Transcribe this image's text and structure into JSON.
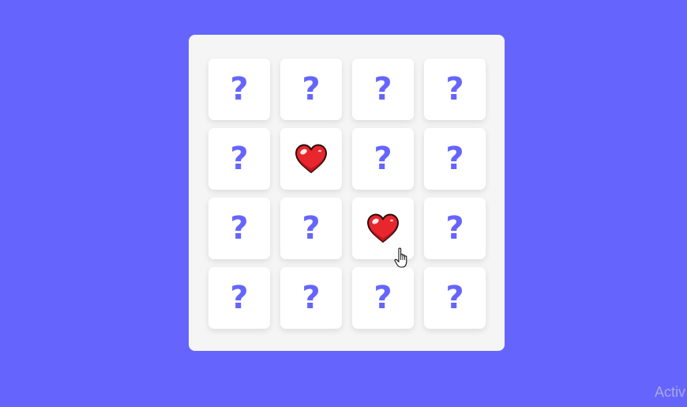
{
  "colors": {
    "background": "#6565fd",
    "board": "#f5f5f5",
    "card": "#ffffff",
    "question_mark": "#6565fd",
    "heart": "#e8262d",
    "watermark": "#a9a9de"
  },
  "hidden_symbol": "?",
  "revealed_symbol_icon": "heart-icon",
  "cards": [
    {
      "state": "hidden"
    },
    {
      "state": "hidden"
    },
    {
      "state": "hidden"
    },
    {
      "state": "hidden"
    },
    {
      "state": "hidden"
    },
    {
      "state": "revealed",
      "icon": "heart-icon"
    },
    {
      "state": "hidden"
    },
    {
      "state": "hidden"
    },
    {
      "state": "hidden"
    },
    {
      "state": "hidden"
    },
    {
      "state": "revealed",
      "icon": "heart-icon"
    },
    {
      "state": "hidden"
    },
    {
      "state": "hidden"
    },
    {
      "state": "hidden"
    },
    {
      "state": "hidden"
    },
    {
      "state": "hidden"
    }
  ],
  "cursor_icon": "pointer-cursor-icon",
  "watermark_text": "Activ"
}
